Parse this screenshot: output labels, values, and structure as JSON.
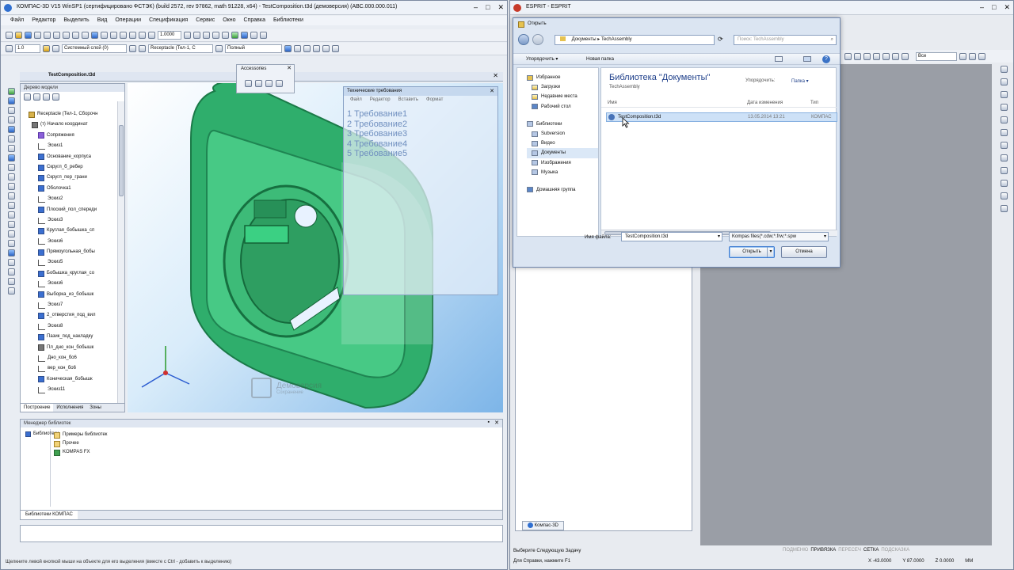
{
  "kompas": {
    "title": "КОМПАС-3D V15 WinSP1 (сертифицировано ФСТЭК) (build 2572, rev 97862, math 91228, x64) - TestComposition.t3d (демоверсия) (АВС.000.000.011)",
    "menu": [
      "Файл",
      "Редактор",
      "Выделить",
      "Вид",
      "Операции",
      "Спецификация",
      "Сервис",
      "Окно",
      "Справка",
      "Библиотеки"
    ],
    "toolbar": {
      "zoom_value": "1.0000",
      "layer": "Системный слой (0)",
      "style": "Receptacle (Тел-1, С",
      "line_style": "Полный",
      "line_value": "1.0"
    },
    "doc_tab": "TestComposition.t3d",
    "accessories_title": "Accessories",
    "tech_req": {
      "title": "Технические требования",
      "menu": [
        "Файл",
        "Редактор",
        "Вставить",
        "Формат"
      ],
      "items": [
        "1   Требование1",
        "2   Требование2",
        "3   Требование3",
        "4   Требование4",
        "5   Требование5"
      ]
    },
    "tree": {
      "title": "Дерево модели",
      "items": [
        "Receptacle (Тел-1, Сборочн",
        "(т) Начало координат",
        "Сопряжения",
        "Эскиз1",
        "Основание_корпуса",
        "Скругл_б_ребер",
        "Скругл_пер_грани",
        "Оболочка1",
        "Эскиз2",
        "Плоский_пол_спереди",
        "Эскиз3",
        "Круглая_бобышка_сп",
        "Эскиз6",
        "Прямоугольная_бобы",
        "Эскиз5",
        "Бобышка_круглая_со",
        "Эскиз6",
        "Выборка_из_бобышк",
        "Эскиз7",
        "2_отверстия_под_вил",
        "Эскиз8",
        "Пазик_под_накладку",
        "Пл_дно_кон_бобышк",
        "Дно_кон_бо6",
        "вер_кон_бо6",
        "Коническая_бобышк",
        "Эскиз11"
      ],
      "tabs": [
        "Построение",
        "Исполнения",
        "Зоны"
      ]
    },
    "watermark": {
      "line1": "Демоверсия",
      "line2": "Сохранение"
    },
    "lib_manager": {
      "title": "Менеджер библиотек",
      "left_item": "Библиотеки",
      "items": [
        "Примеры библиотек",
        "Прочее",
        "KOMPAS FX"
      ],
      "tab": "Библиотеки КОМПАС"
    },
    "status": "Щелкните левой кнопкой мыши на объекте для его выделения (вместе с Ctrl - добавить к выделению)"
  },
  "espirit": {
    "title": "ESPRIT - ESPRIT",
    "project_tab": "Компас-3D",
    "status_lines": [
      "Выберите Следующую Задачу",
      "Для Справки, нажмите F1"
    ],
    "status_modes": [
      "ПОДМЕНЮ",
      "ПРИВЯЗКА",
      "ПЕРЕСЕЧ",
      "СЕТКА",
      "ПОДСКАЗКА"
    ],
    "coords": [
      "X  -43.0000",
      "Y  87.0000",
      "Z  0.0000",
      "MM"
    ],
    "filter_select": "Все"
  },
  "dialog": {
    "title": "Открыть",
    "breadcrumb": [
      "Документы",
      "TechAssembly"
    ],
    "search_placeholder": "Поиск: TechAssembly",
    "organize": "Упорядочить ▾",
    "new_folder": "Новая папка",
    "nav": {
      "favorites": "Избранное",
      "fav_items": [
        "Загрузки",
        "Недавние места",
        "Рабочий стол"
      ],
      "libraries": "Библиотеки",
      "lib_items": [
        "Subversion",
        "Видео",
        "Документы",
        "Изображения",
        "Музыка"
      ],
      "homegroup": "Домашняя группа"
    },
    "library_title": "Библиотека \"Документы\"",
    "library_sub": "TechAssembly",
    "arrange_label": "Упорядочить:",
    "arrange_value": "Папка ▾",
    "columns": [
      "Имя",
      "Дата изменения",
      "Тип"
    ],
    "file": {
      "name": "TestComposition.t3d",
      "date": "13.05.2014 13:21",
      "type": "КОМПАС"
    },
    "filename_label": "Имя файла:",
    "filename_value": "TestComposition.t3d",
    "filter_value": "Kompas files(*.cdw;*.frw;*.spw",
    "open_label": "Открыть",
    "cancel_label": "Отмена"
  }
}
